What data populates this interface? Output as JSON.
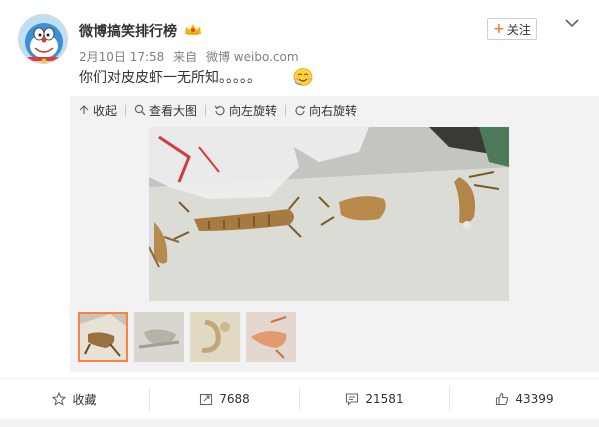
{
  "post": {
    "author": "微博搞笑排行榜",
    "date": "2月10日 17:58",
    "source_prefix": "来自",
    "source": "微博 weibo.com",
    "text": "你们对皮皮虾一无所知。。。。。",
    "emoji_icon": "smile-emoji-icon"
  },
  "follow_button": {
    "plus": "+",
    "label": "关注"
  },
  "media_toolbar": {
    "collapse": "收起",
    "view_large": "查看大图",
    "rotate_left": "向左旋转",
    "rotate_right": "向右旋转"
  },
  "thumbnails": {
    "count": 4,
    "selected_index": 0
  },
  "actions": {
    "favorite": "收藏",
    "repost": "7688",
    "comment": "21581",
    "like": "43399"
  },
  "colors": {
    "accent": "#ff8140",
    "text": "#333333",
    "meta": "#808080",
    "media_bg": "#f2f2f5"
  }
}
